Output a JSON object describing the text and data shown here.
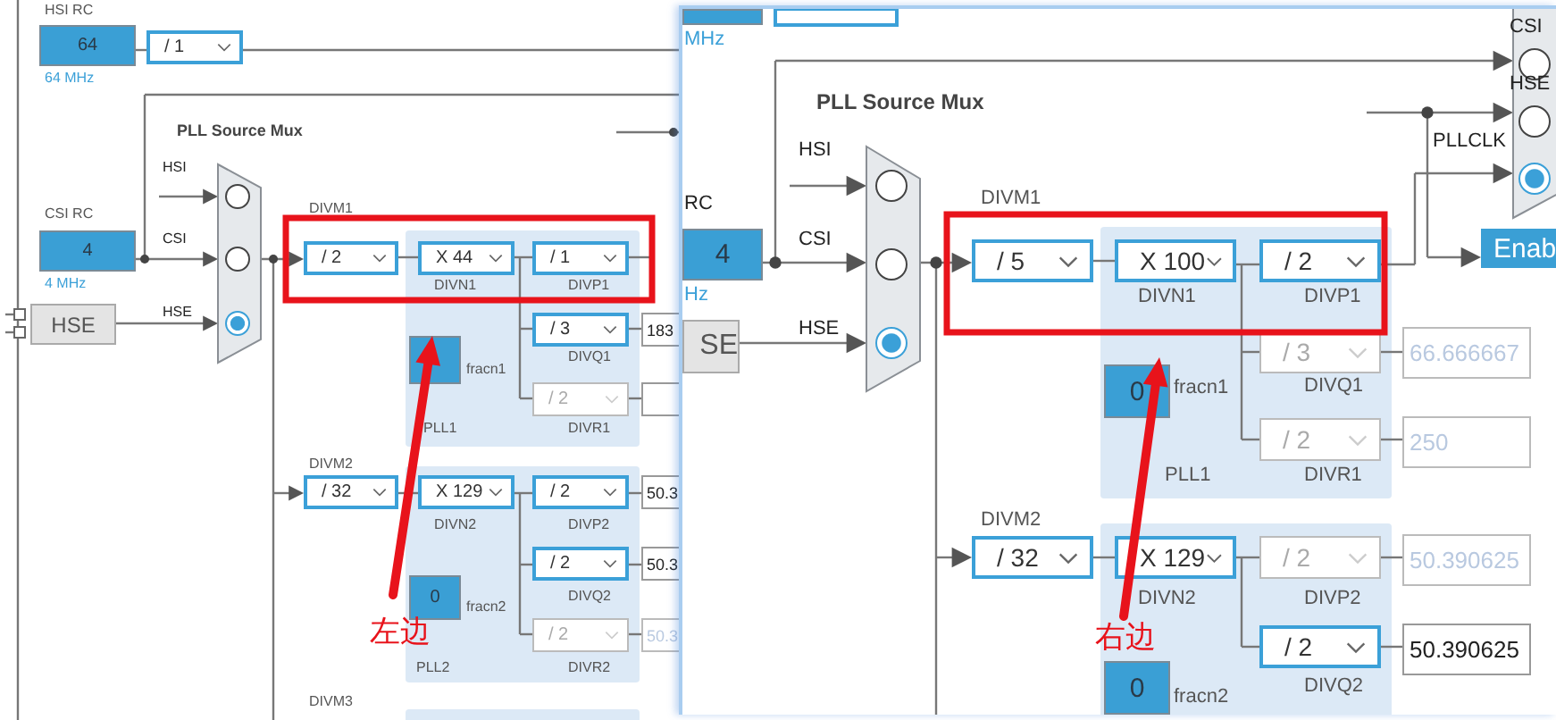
{
  "left_screenshot": {
    "labels": [
      {
        "text": "HSI RC",
        "kind": "plain"
      },
      {
        "text": "64 MHz",
        "kind": "freq"
      },
      {
        "text": "PLL Source Mux",
        "kind": "bold"
      },
      {
        "text": "HSI",
        "kind": "signal"
      },
      {
        "text": "CSI RC",
        "kind": "plain"
      },
      {
        "text": "CSI",
        "kind": "signal"
      },
      {
        "text": "4 MHz",
        "kind": "freq"
      },
      {
        "text": "HSE",
        "kind": "signal"
      },
      {
        "text": "DIVM1",
        "kind": "plain"
      },
      {
        "text": "DIVN1",
        "kind": "plain"
      },
      {
        "text": "DIVP1",
        "kind": "plain"
      },
      {
        "text": "DIVQ1",
        "kind": "plain"
      },
      {
        "text": "fracn1",
        "kind": "plain"
      },
      {
        "text": "PLL1",
        "kind": "plain"
      },
      {
        "text": "DIVR1",
        "kind": "plain"
      },
      {
        "text": "DIVM2",
        "kind": "plain"
      },
      {
        "text": "DIVN2",
        "kind": "plain"
      },
      {
        "text": "DIVP2",
        "kind": "plain"
      },
      {
        "text": "fracn2",
        "kind": "plain"
      },
      {
        "text": "DIVQ2",
        "kind": "plain"
      },
      {
        "text": "PLL2",
        "kind": "plain"
      },
      {
        "text": "DIVR2",
        "kind": "plain"
      },
      {
        "text": "DIVM3",
        "kind": "plain"
      }
    ],
    "dropdowns": [
      {
        "value": "/ 1",
        "disabled": false
      },
      {
        "value": "/ 2",
        "disabled": false
      },
      {
        "value": "X 44",
        "disabled": false
      },
      {
        "value": "/ 1",
        "disabled": false
      },
      {
        "value": "/ 3",
        "disabled": false
      },
      {
        "value": "/ 2",
        "disabled": true
      },
      {
        "value": "/ 32",
        "disabled": false
      },
      {
        "value": "X 129",
        "disabled": false
      },
      {
        "value": "/ 2",
        "disabled": false
      },
      {
        "value": "/ 2",
        "disabled": false
      },
      {
        "value": "/ 2",
        "disabled": true
      }
    ],
    "value_boxes": [
      {
        "value": "64"
      },
      {
        "value": "4"
      },
      {
        "value": "0"
      }
    ],
    "source_buttons": [
      {
        "label": "HSE"
      }
    ],
    "outputs": [
      {
        "value": "183",
        "disabled": false
      },
      {
        "disabled": false
      },
      {
        "value": "50.3",
        "disabled": false
      },
      {
        "value": "50.3",
        "disabled": false
      },
      {
        "value": "50.3",
        "disabled": true
      }
    ],
    "muxes": [
      {
        "inputs": [
          {
            "selected": false
          },
          {
            "selected": false
          },
          {
            "selected": true
          }
        ]
      }
    ],
    "annotation": {
      "label": "左边"
    }
  },
  "right_screenshot": {
    "labels": [
      {
        "text": "MHz",
        "kind": "freq"
      },
      {
        "text": "CSI",
        "kind": "signal"
      },
      {
        "text": "HSE",
        "kind": "signal"
      },
      {
        "text": "PLLCLK",
        "kind": "signal"
      },
      {
        "text": "PLL Source Mux",
        "kind": "bold"
      },
      {
        "text": "HSI",
        "kind": "signal"
      },
      {
        "text": "RC",
        "kind": "signal"
      },
      {
        "text": "CSI",
        "kind": "signal"
      },
      {
        "text": "Hz",
        "kind": "freq"
      },
      {
        "text": "HSE",
        "kind": "signal"
      },
      {
        "text": "DIVM1",
        "kind": "plain"
      },
      {
        "text": "DIVN1",
        "kind": "plain"
      },
      {
        "text": "DIVP1",
        "kind": "plain"
      },
      {
        "text": "DIVQ1",
        "kind": "plain"
      },
      {
        "text": "fracn1",
        "kind": "plain"
      },
      {
        "text": "PLL1",
        "kind": "plain"
      },
      {
        "text": "DIVR1",
        "kind": "plain"
      },
      {
        "text": "DIVM2",
        "kind": "plain"
      },
      {
        "text": "DIVN2",
        "kind": "plain"
      },
      {
        "text": "DIVP2",
        "kind": "plain"
      },
      {
        "text": "DIVQ2",
        "kind": "plain"
      },
      {
        "text": "fracn2",
        "kind": "plain"
      }
    ],
    "dropdowns": [
      {
        "value": "/ 5",
        "disabled": false
      },
      {
        "value": "X 100",
        "disabled": false
      },
      {
        "value": "/ 2",
        "disabled": false
      },
      {
        "value": "/ 3",
        "disabled": true
      },
      {
        "value": "/ 2",
        "disabled": true
      },
      {
        "value": "/ 32",
        "disabled": false
      },
      {
        "value": "X 129",
        "disabled": false
      },
      {
        "value": "/ 2",
        "disabled": true
      },
      {
        "value": "/ 2",
        "disabled": false
      }
    ],
    "value_boxes": [
      {
        "value": "4"
      },
      {
        "value": "0"
      },
      {
        "value": "0"
      }
    ],
    "source_buttons": [
      {
        "label": "SE"
      }
    ],
    "buttons": [
      {
        "label": "Enab"
      }
    ],
    "outputs": [
      {
        "value": "66.666667",
        "disabled": true
      },
      {
        "value": "250",
        "disabled": true
      },
      {
        "value": "50.390625",
        "disabled": true
      },
      {
        "value": "50.390625",
        "disabled": false
      }
    ],
    "muxes": [
      {
        "inputs": [
          {
            "selected": false
          },
          {
            "selected": false
          },
          {
            "selected": true
          }
        ]
      },
      {
        "inputs": [
          {
            "selected": false
          },
          {
            "selected": false
          },
          {
            "selected": true
          }
        ]
      }
    ],
    "annotation": {
      "label": "右边"
    }
  }
}
